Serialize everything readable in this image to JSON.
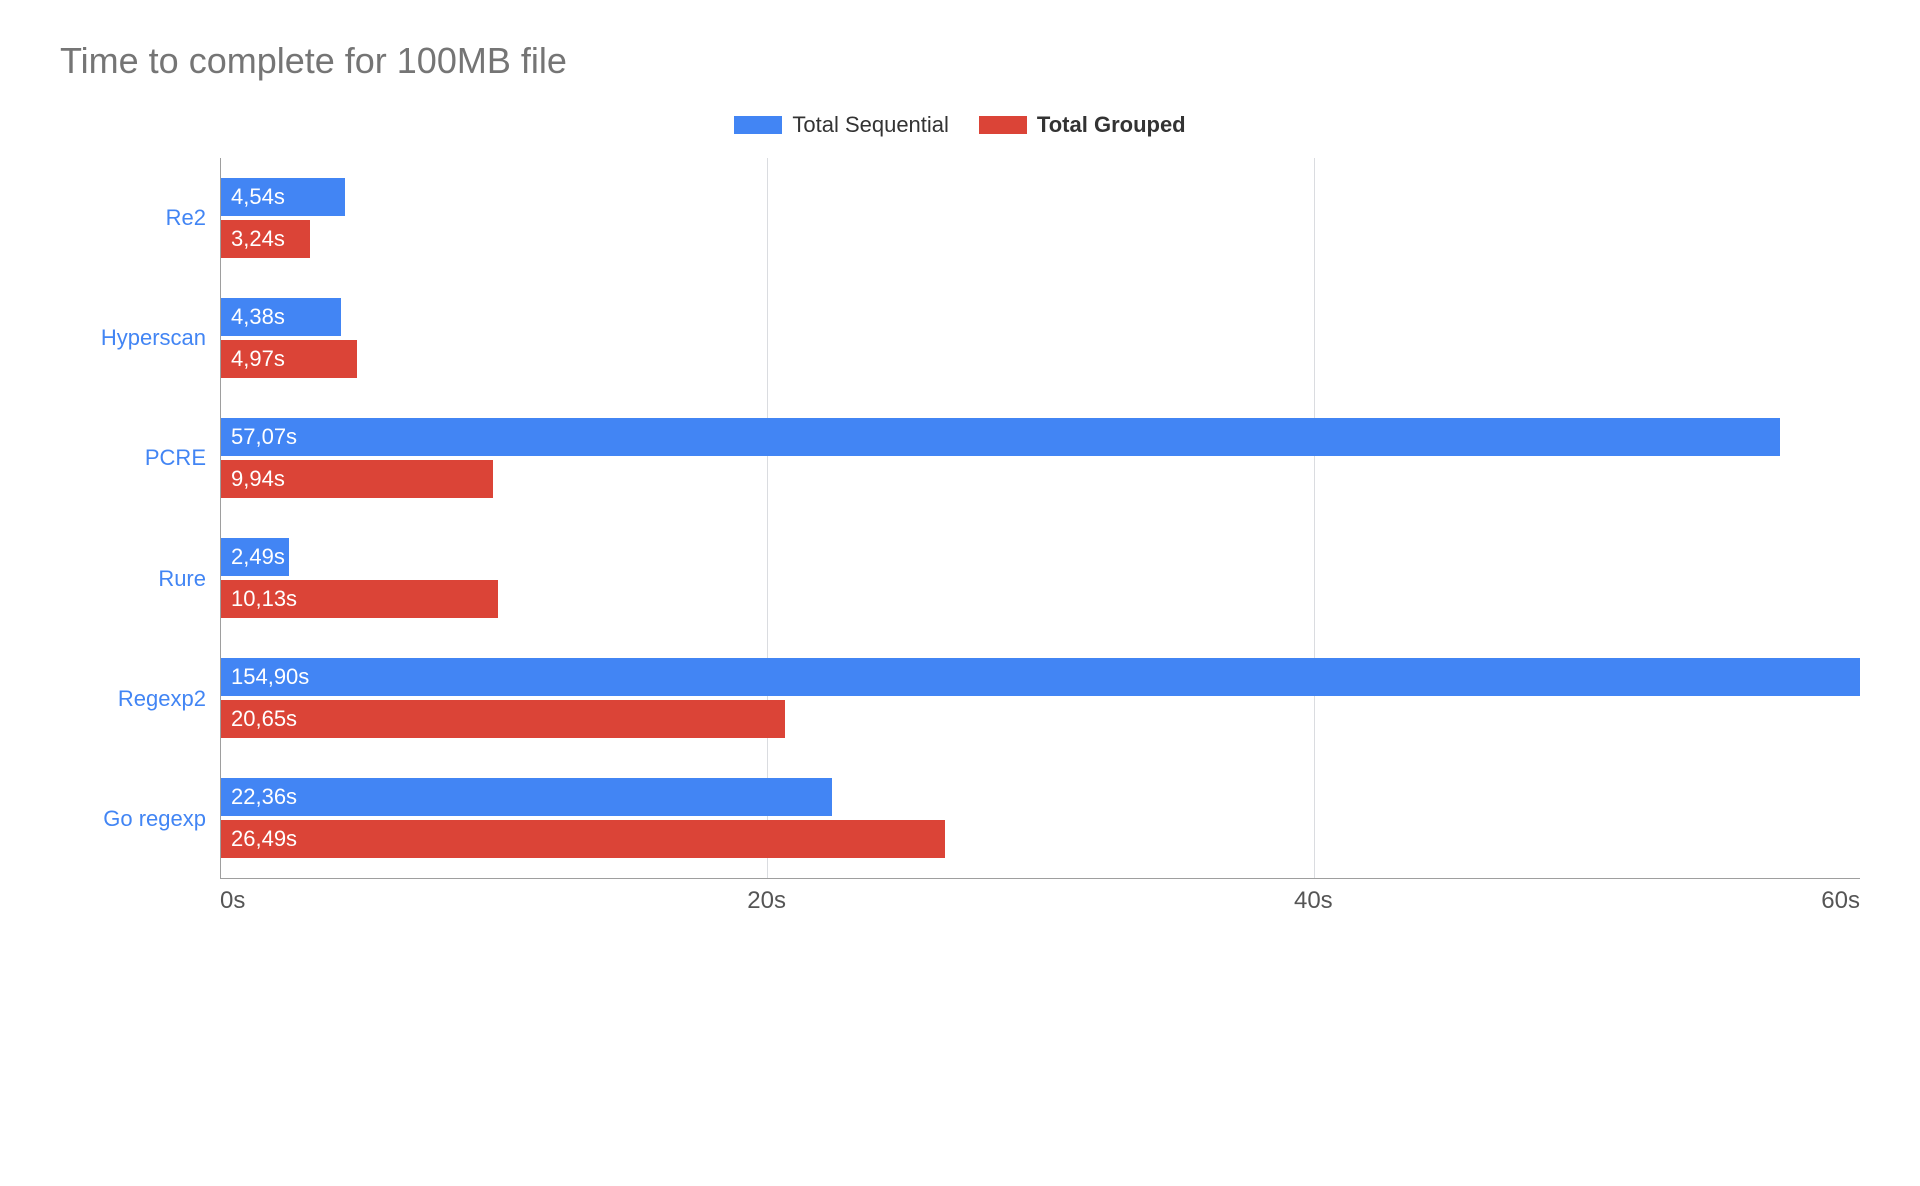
{
  "chart_data": {
    "type": "bar",
    "orientation": "horizontal",
    "title": "Time to complete for 100MB file",
    "xlabel": "",
    "ylabel": "",
    "xlim": [
      0,
      60
    ],
    "x_ticks": [
      "0s",
      "20s",
      "40s",
      "60s"
    ],
    "categories": [
      "Re2",
      "Hyperscan",
      "PCRE",
      "Rure",
      "Regexp2",
      "Go regexp"
    ],
    "series": [
      {
        "name": "Total Sequential",
        "color": "#4285f4",
        "values": [
          4.54,
          4.38,
          57.07,
          2.49,
          154.9,
          22.36
        ],
        "labels": [
          "4,54s",
          "4,38s",
          "57,07s",
          "2,49s",
          "154,90s",
          "22,36s"
        ]
      },
      {
        "name": "Total Grouped",
        "color": "#db4437",
        "bold": true,
        "values": [
          3.24,
          4.97,
          9.94,
          10.13,
          20.65,
          26.49
        ],
        "labels": [
          "3,24s",
          "4,97s",
          "9,94s",
          "10,13s",
          "20,65s",
          "26,49s"
        ]
      }
    ]
  }
}
